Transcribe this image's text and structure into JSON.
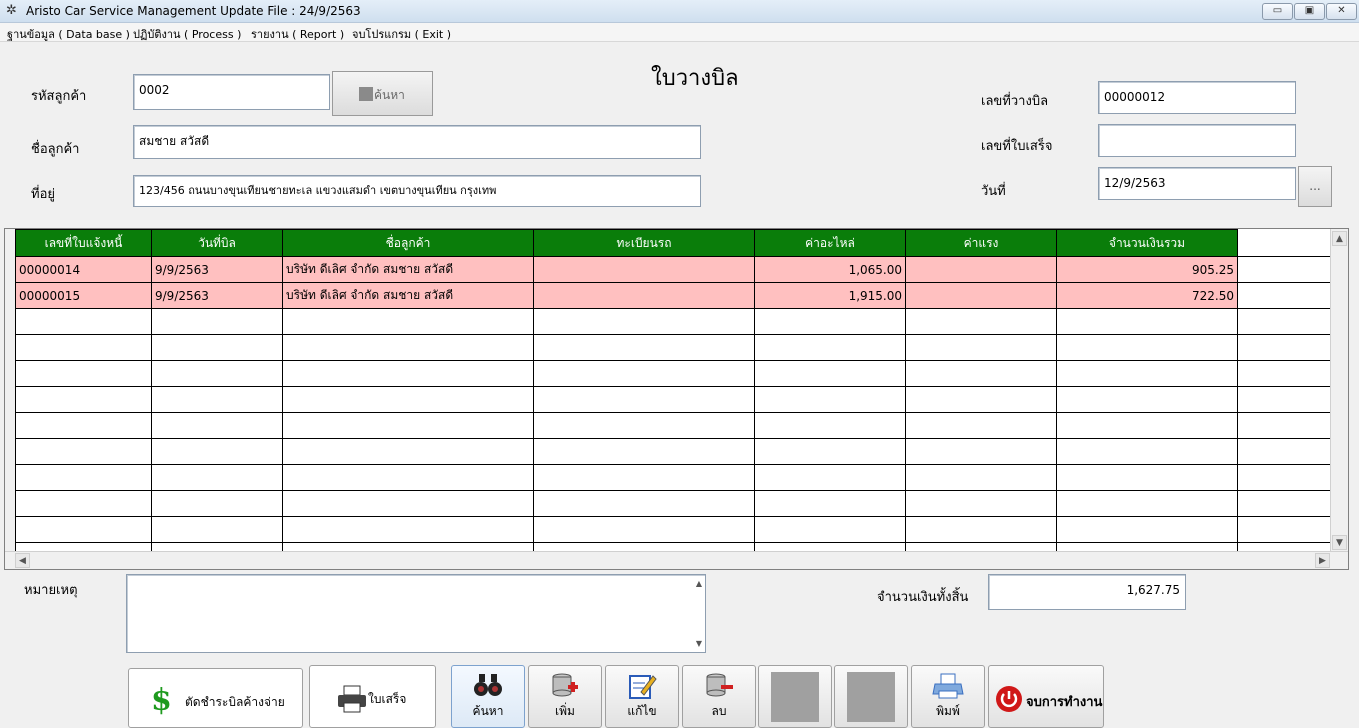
{
  "window": {
    "title": "Aristo Car Service Management   Update File : 24/9/2563",
    "minimize": "▭",
    "maximize": "▣",
    "close": "✕"
  },
  "menu": [
    "ฐานข้อมูล ( Data base )",
    "ปฏิบัติงาน ( Process )",
    "รายงาน ( Report )",
    "จบโปรแกรม ( Exit )"
  ],
  "form": {
    "title": "ใบวางบิล",
    "customer_code_label": "รหัสลูกค้า",
    "customer_code": "0002",
    "search_button": "ค้นหา",
    "customer_name_label": "ชื่อลูกค้า",
    "customer_name": "สมชาย สวัสดี",
    "address_label": "ที่อยู่",
    "address": "123/456  ถนนบางขุนเทียนชายทะเล แขวงแสมดำ เขตบางขุนเทียน กรุงเทพ",
    "bill_no_label": "เลขที่วางบิล",
    "bill_no": "00000012",
    "receipt_no_label": "เลขที่ใบเสร็จ",
    "receipt_no": "",
    "date_label": "วันที่",
    "date": "12/9/2563",
    "date_picker_button": "..."
  },
  "grid": {
    "columns": [
      "เลขที่ใบแจ้งหนี้",
      "วันที่บิล",
      "ชื่อลูกค้า",
      "ทะเบียนรถ",
      "ค่าอะไหล่",
      "ค่าแรง",
      "จำนวนเงินรวม"
    ],
    "rows": [
      [
        "00000014",
        "9/9/2563",
        "บริษัท ดีเลิศ  จำกัด  สมชาย สวัสดี",
        "",
        "1,065.00",
        "",
        "905.25"
      ],
      [
        "00000015",
        "9/9/2563",
        "บริษัท ดีเลิศ  จำกัด  สมชาย สวัสดี",
        "",
        "1,915.00",
        "",
        "722.50"
      ]
    ]
  },
  "notes": {
    "label": "หมายเหตุ",
    "value": ""
  },
  "total": {
    "label": "จำนวนเงินทั้งสิ้น",
    "value": "1,627.75"
  },
  "actions": {
    "pay_bill": "ตัดชำระบิลค้างจ่าย",
    "receipt": "ใบเสร็จ",
    "search": "ค้นหา",
    "add": "เพิ่ม",
    "edit": "แก้ไข",
    "delete": "ลบ",
    "print": "พิมพ์",
    "exit": "จบการทำงาน"
  },
  "colors": {
    "header_green": "#0a7d0a",
    "row_highlight": "#ffc0c0",
    "exit_red": "#d01818"
  }
}
